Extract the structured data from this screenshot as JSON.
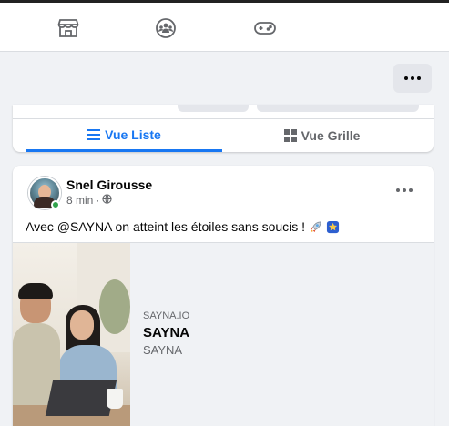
{
  "top_nav": {
    "icons": [
      "marketplace-icon",
      "groups-icon",
      "gaming-icon"
    ]
  },
  "view_toggle": {
    "list_label": "Vue Liste",
    "grid_label": "Vue Grille",
    "active": "list"
  },
  "post": {
    "author": "Snel Girousse",
    "time": "8 min",
    "privacy_icon": "globe-icon",
    "text": "Avec @SAYNA on atteint les étoiles sans soucis !",
    "emojis": [
      "rocket-icon",
      "star-badge-icon"
    ],
    "link_preview": {
      "domain": "SAYNA.IO",
      "title": "SAYNA",
      "description": "SAYNA"
    }
  },
  "colors": {
    "accent": "#1877f2",
    "secondary_text": "#65676b",
    "online": "#31a24c",
    "background": "#f0f2f5"
  }
}
